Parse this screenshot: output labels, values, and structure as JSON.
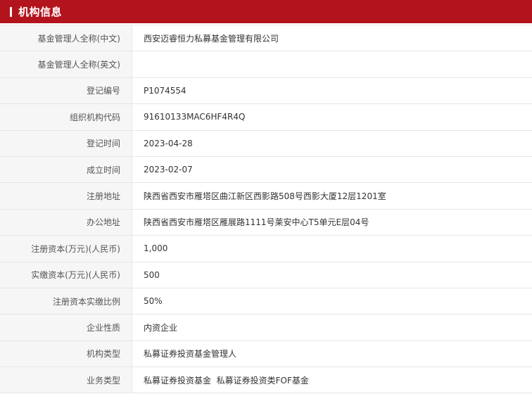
{
  "header": {
    "title": "机构信息",
    "accent_color": "#b3131c"
  },
  "rows": [
    {
      "label": "基金管理人全称(中文)",
      "value": "西安迈睿恒力私募基金管理有限公司"
    },
    {
      "label": "基金管理人全称(英文)",
      "value": ""
    },
    {
      "label": "登记编号",
      "value": "P1074554"
    },
    {
      "label": "组织机构代码",
      "value": "91610133MAC6HF4R4Q"
    },
    {
      "label": "登记时间",
      "value": "2023-04-28"
    },
    {
      "label": "成立时间",
      "value": "2023-02-07"
    },
    {
      "label": "注册地址",
      "value": "陕西省西安市雁塔区曲江新区西影路508号西影大厦12层1201室"
    },
    {
      "label": "办公地址",
      "value": "陕西省西安市雁塔区雁展路1111号莱安中心T5单元E层04号"
    },
    {
      "label": "注册资本(万元)(人民币)",
      "value": "1,000"
    },
    {
      "label": "实缴资本(万元)(人民币)",
      "value": "500"
    },
    {
      "label": "注册资本实缴比例",
      "value": "50%"
    },
    {
      "label": "企业性质",
      "value": "内资企业"
    },
    {
      "label": "机构类型",
      "value": "私募证券投资基金管理人"
    },
    {
      "label": "业务类型",
      "value": "私募证券投资基金  私募证券投资类FOF基金"
    }
  ]
}
